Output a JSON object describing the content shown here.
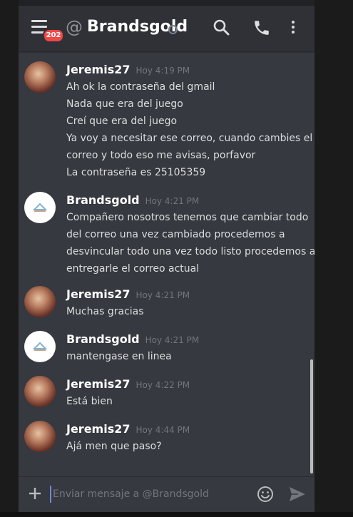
{
  "header": {
    "title": "Brandsgold",
    "badge": "202",
    "at_symbol": "@"
  },
  "messages": [
    {
      "author": "Jeremis27",
      "time": "Hoy 4:19 PM",
      "avatar": "user",
      "lines": [
        "Ah ok la contraseña del gmail",
        "Nada que era del juego",
        "Creí que era del juego",
        "Ya voy a necesitar ese correo, cuando cambies el",
        "correo y todo eso me avisas, porfavor",
        "La contraseña es 25105359"
      ]
    },
    {
      "author": "Brandsgold",
      "time": "Hoy 4:21 PM",
      "avatar": "brand",
      "lines": [
        "Compañero nosotros tenemos que cambiar todo",
        "del correo una vez cambiado procedemos a",
        "desvincular todo una vez todo listo procedemos a",
        "entregarle el correo actual"
      ]
    },
    {
      "author": "Jeremis27",
      "time": "Hoy 4:21 PM",
      "avatar": "user",
      "lines": [
        "Muchas gracias"
      ]
    },
    {
      "author": "Brandsgold",
      "time": "Hoy 4:21 PM",
      "avatar": "brand",
      "lines": [
        "mantengase en linea"
      ]
    },
    {
      "author": "Jeremis27",
      "time": "Hoy 4:22 PM",
      "avatar": "user",
      "lines": [
        "Está bien"
      ]
    },
    {
      "author": "Jeremis27",
      "time": "Hoy 4:44 PM",
      "avatar": "user",
      "lines": [
        "Ajá men que paso?"
      ]
    }
  ],
  "composer": {
    "placeholder": "Enviar mensaje a @Brandsgold"
  },
  "icons": {
    "menu": "hamburger-menu-icon",
    "search": "search-icon",
    "call": "phone-icon",
    "more": "more-vertical-icon",
    "add": "plus-icon",
    "emoji": "emoji-icon",
    "send": "send-icon"
  },
  "colors": {
    "background": "#36393f",
    "header": "#2f3136",
    "badge": "#f04747",
    "accent": "#7289da"
  }
}
